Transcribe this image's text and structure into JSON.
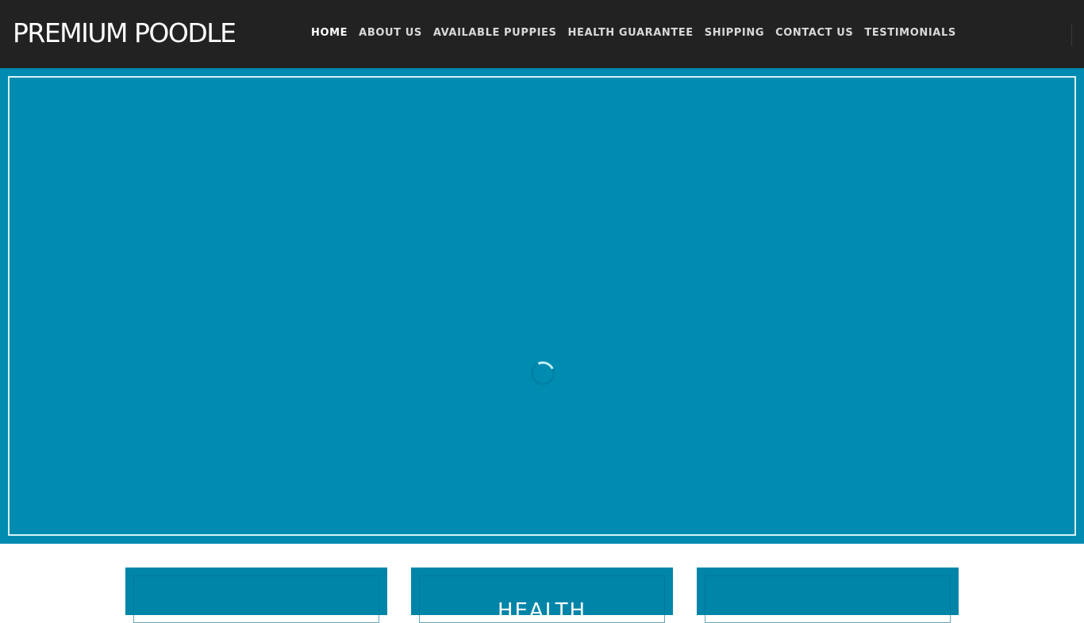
{
  "header": {
    "logo": "PREMIUM POODLE",
    "nav": [
      {
        "label": "HOME",
        "active": true
      },
      {
        "label": "ABOUT US",
        "active": false
      },
      {
        "label": "AVAILABLE PUPPIES",
        "active": false
      },
      {
        "label": "HEALTH GUARANTEE",
        "active": false
      },
      {
        "label": "SHIPPING",
        "active": false
      },
      {
        "label": "CONTACT US",
        "active": false
      },
      {
        "label": "TESTIMONIALS",
        "active": false
      }
    ]
  },
  "hero": {
    "status": "loading",
    "spinner_icon": "loading-spinner-icon"
  },
  "cards": [
    {
      "title": ""
    },
    {
      "title": "HEALTH"
    },
    {
      "title": ""
    }
  ],
  "colors": {
    "header_bg": "#222222",
    "accent": "#008bb0",
    "card_bg": "#0085a8",
    "frame_border": "#d8f4f7"
  }
}
